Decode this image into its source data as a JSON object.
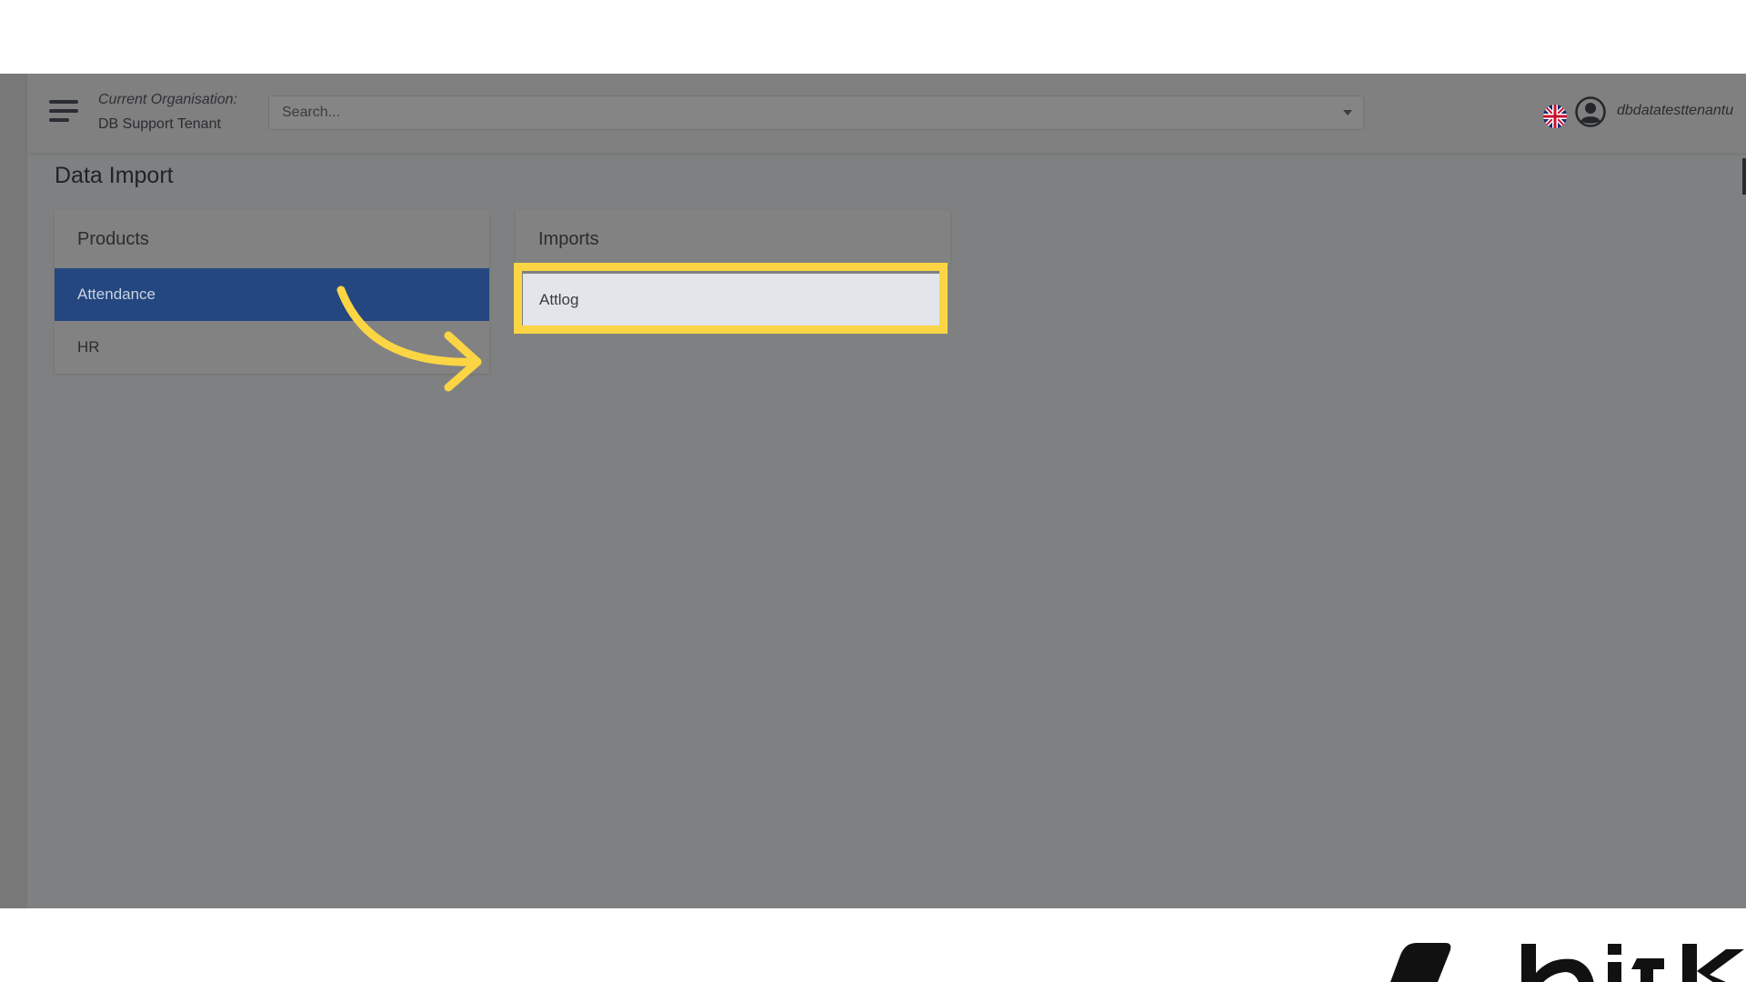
{
  "header": {
    "org_label": "Current Organisation:",
    "org_name": "DB Support Tenant",
    "search_placeholder": "Search...",
    "username": "dbdatatesttenantu"
  },
  "page": {
    "title": "Data Import"
  },
  "products": {
    "header": "Products",
    "items": [
      {
        "label": "Attendance",
        "active": true
      },
      {
        "label": "HR",
        "active": false
      }
    ]
  },
  "imports": {
    "header": "Imports",
    "items": [
      {
        "label": "Attlog"
      }
    ]
  },
  "annotation": {
    "highlight_color": "#fbd544",
    "arrow_color": "#fbd544"
  },
  "colors": {
    "active_item_bg": "#24477f",
    "overlay_gray": "#7f8081"
  },
  "icons": {
    "menu": "hamburger-menu-icon",
    "flag": "uk-flag-icon",
    "user": "user-avatar-icon",
    "dropdown": "chevron-down-icon",
    "logo": "brand-logo-icon"
  }
}
